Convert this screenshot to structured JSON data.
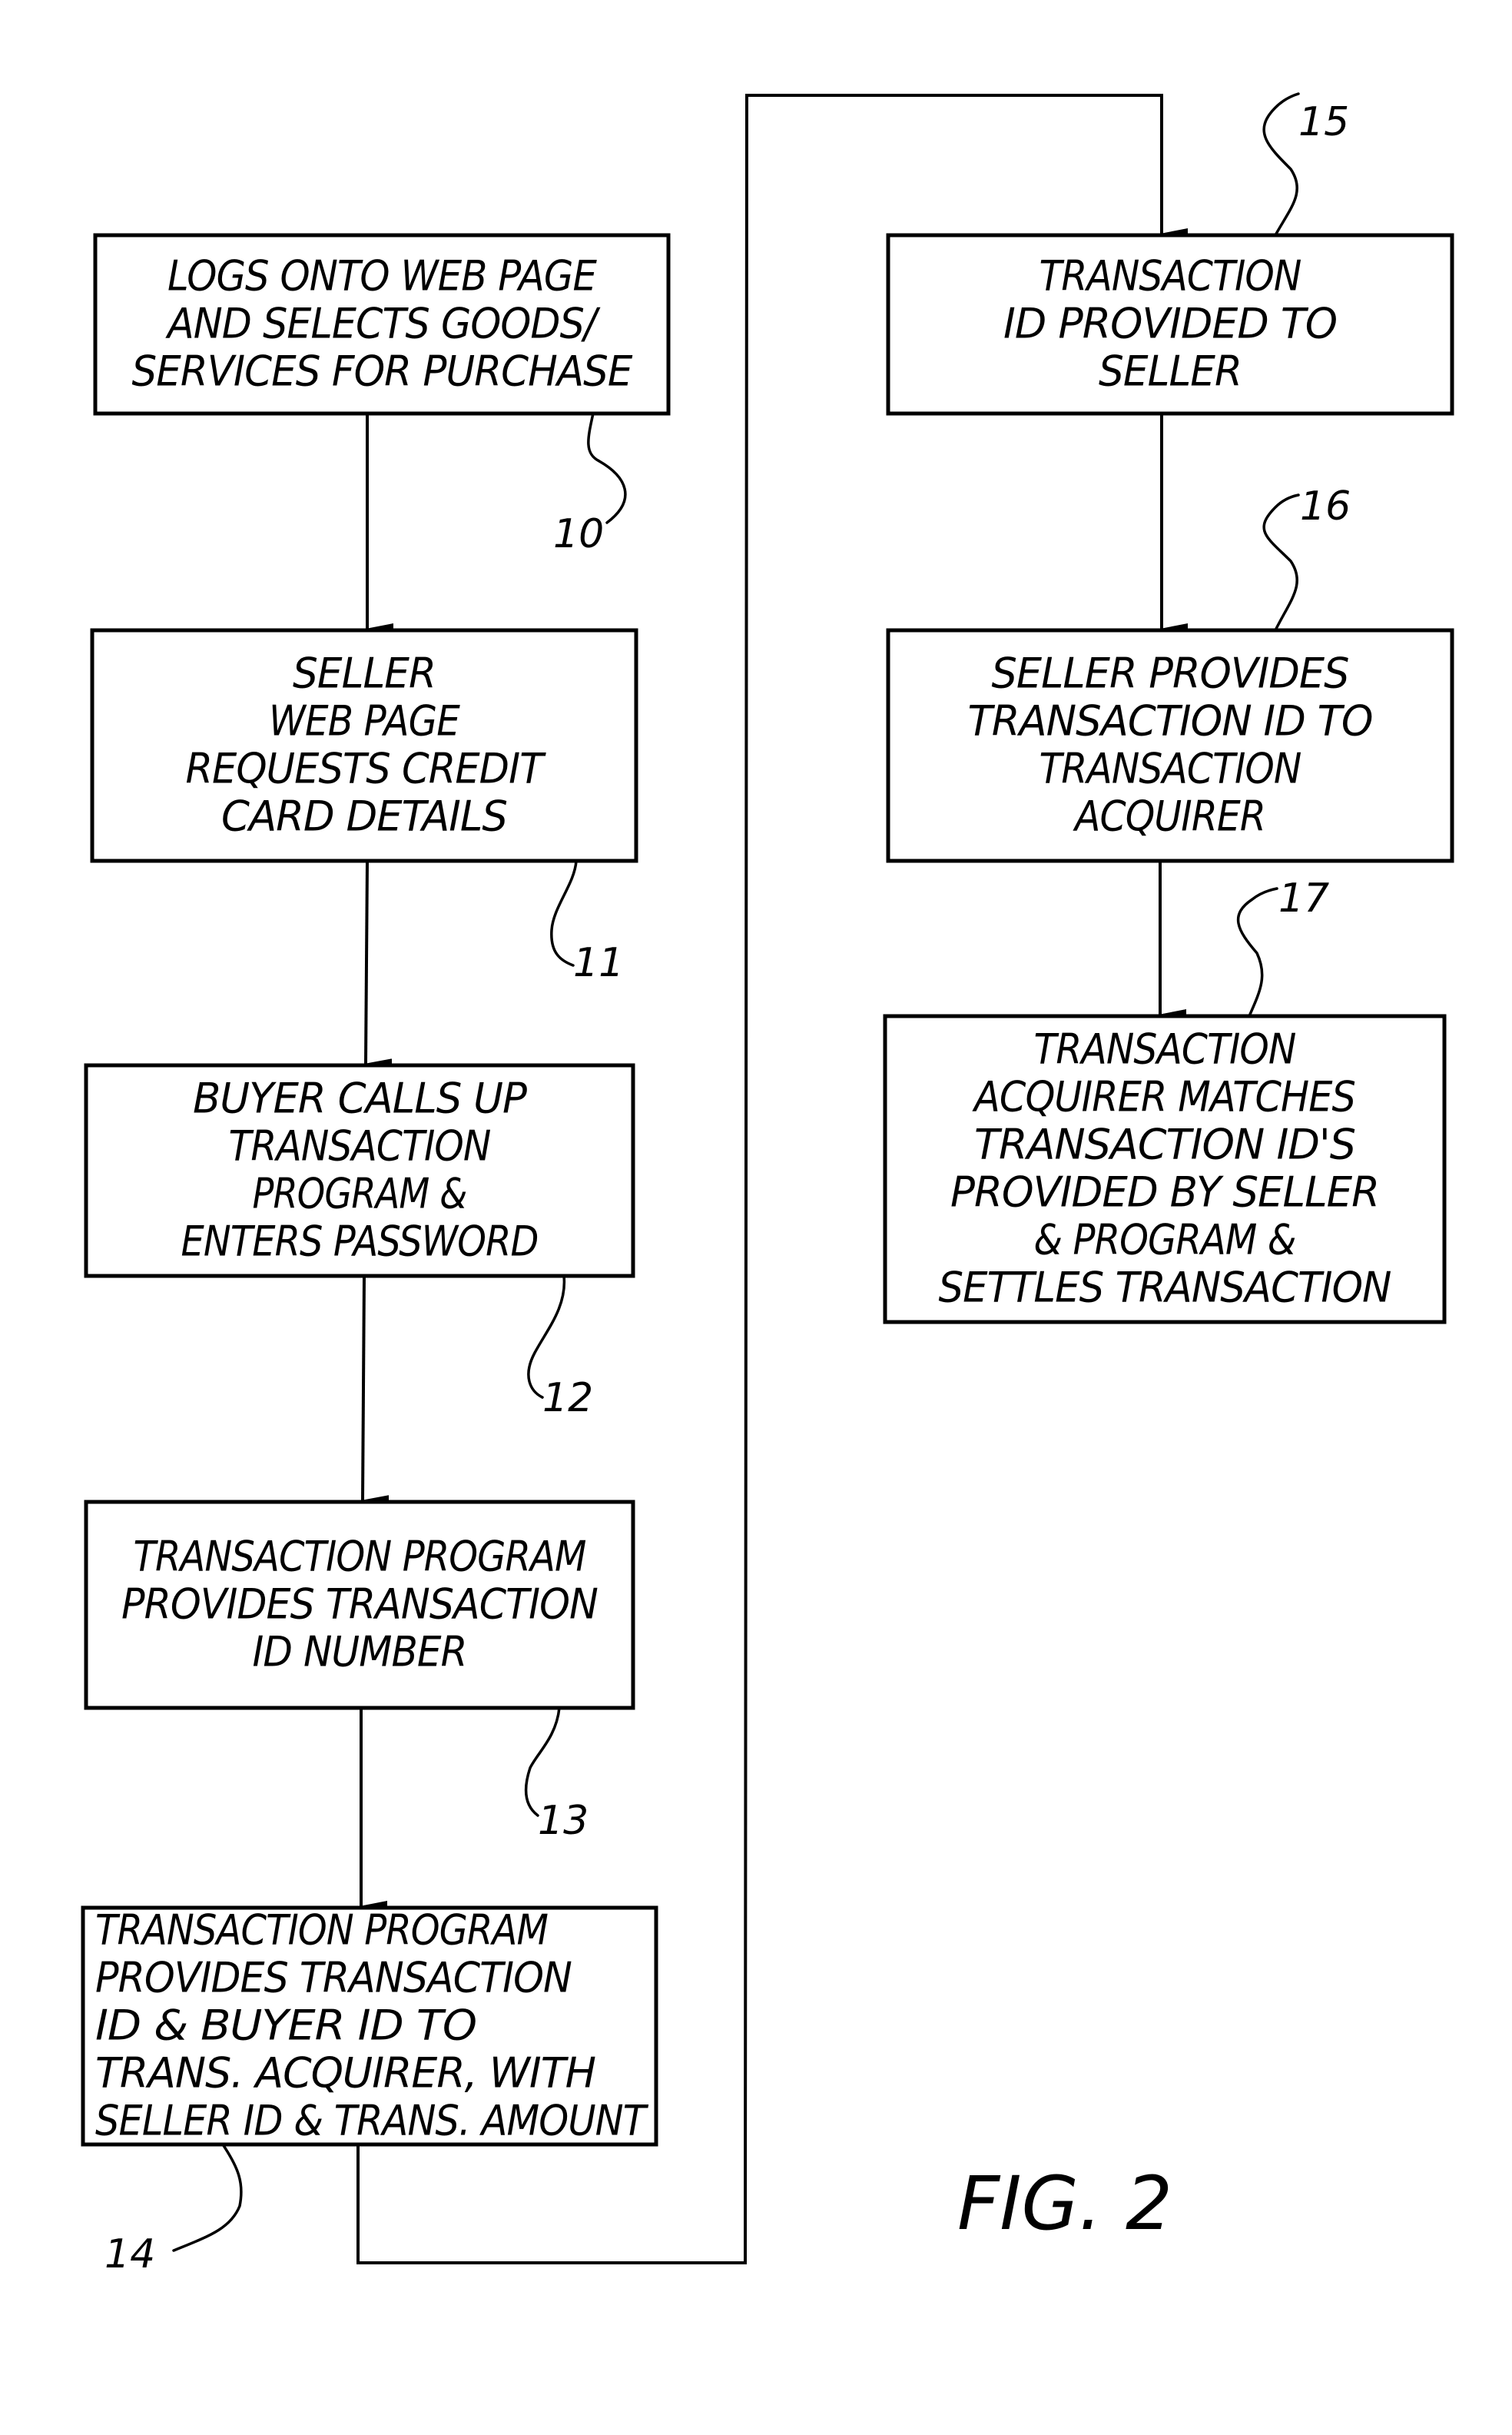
{
  "figure": {
    "label": "FIG. 2",
    "type": "flowchart"
  },
  "steps": [
    {
      "ref": "10",
      "lines": [
        "LOGS ONTO WEB PAGE",
        "AND SELECTS GOODS/",
        "SERVICES FOR PURCHASE"
      ]
    },
    {
      "ref": "11",
      "lines": [
        "SELLER",
        "WEB PAGE",
        "REQUESTS CREDIT",
        "CARD DETAILS"
      ]
    },
    {
      "ref": "12",
      "lines": [
        "BUYER CALLS UP",
        "TRANSACTION",
        "PROGRAM &",
        "ENTERS PASSWORD"
      ]
    },
    {
      "ref": "13",
      "lines": [
        "TRANSACTION PROGRAM",
        "PROVIDES TRANSACTION",
        "ID NUMBER"
      ]
    },
    {
      "ref": "14",
      "lines": [
        "TRANSACTION PROGRAM",
        "PROVIDES TRANSACTION",
        "ID & BUYER ID TO",
        "TRANS. ACQUIRER, WITH",
        "SELLER ID & TRANS. AMOUNT"
      ]
    },
    {
      "ref": "15",
      "lines": [
        "TRANSACTION",
        "ID PROVIDED TO",
        "SELLER"
      ]
    },
    {
      "ref": "16",
      "lines": [
        "SELLER PROVIDES",
        "TRANSACTION ID TO",
        "TRANSACTION",
        "ACQUIRER"
      ]
    },
    {
      "ref": "17",
      "lines": [
        "TRANSACTION",
        "ACQUIRER MATCHES",
        "TRANSACTION ID'S",
        "PROVIDED BY SELLER",
        "& PROGRAM &",
        "SETTLES TRANSACTION"
      ]
    }
  ],
  "flow": [
    {
      "from": "10",
      "to": "11"
    },
    {
      "from": "11",
      "to": "12"
    },
    {
      "from": "12",
      "to": "13"
    },
    {
      "from": "13",
      "to": "14"
    },
    {
      "from": "14",
      "to": "15"
    },
    {
      "from": "15",
      "to": "16"
    },
    {
      "from": "16",
      "to": "17"
    }
  ]
}
